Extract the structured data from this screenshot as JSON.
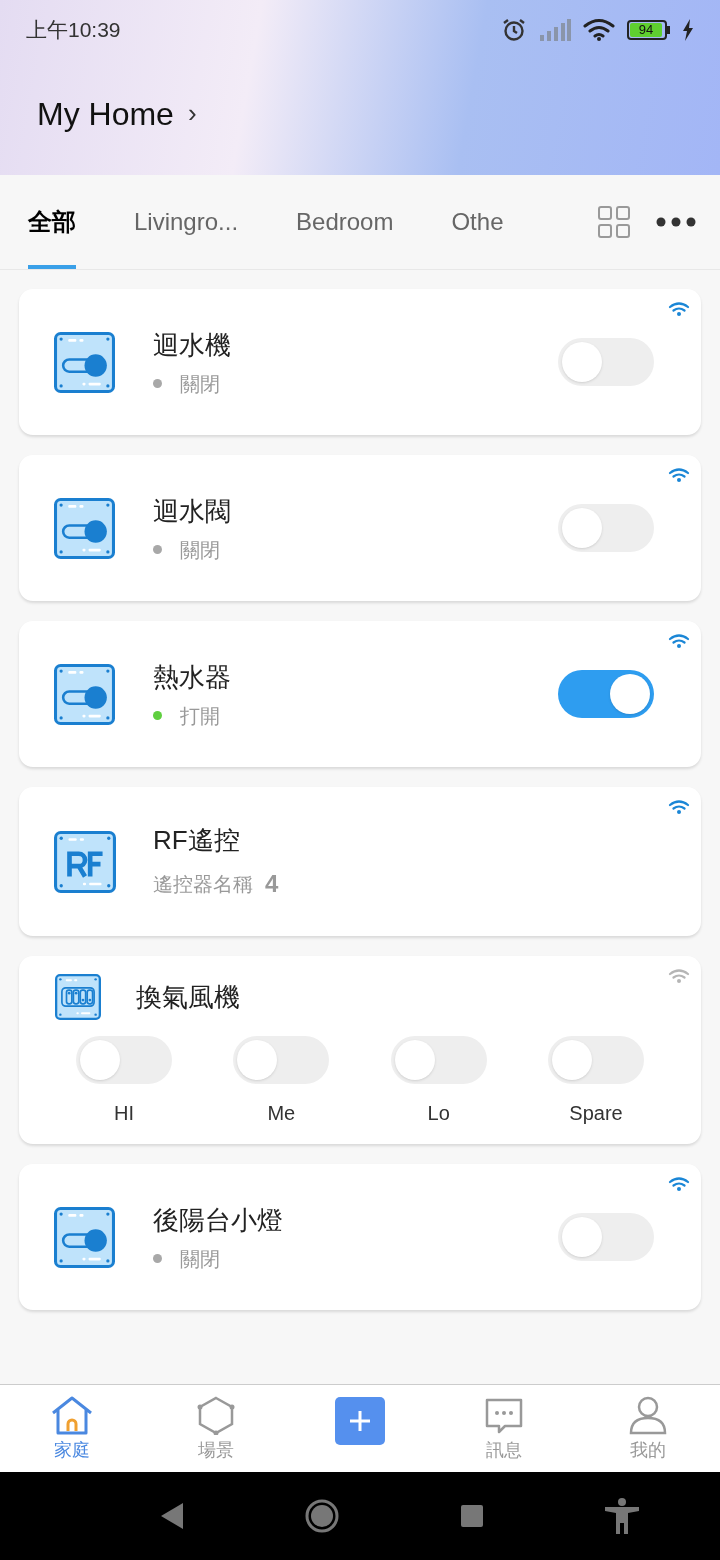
{
  "status_bar": {
    "time": "上午10:39",
    "battery": "94"
  },
  "header": {
    "title": "My Home",
    "chevron": "›"
  },
  "tabs": [
    {
      "label": "全部",
      "selected": true
    },
    {
      "label": "Livingro...",
      "selected": false
    },
    {
      "label": "Bedroom",
      "selected": false
    },
    {
      "label": "Othe",
      "selected": false
    }
  ],
  "devices": [
    {
      "kind": "switch",
      "name": "迴水機",
      "online": true,
      "on": false,
      "status": "關閉"
    },
    {
      "kind": "switch",
      "name": "迴水閥",
      "online": true,
      "on": false,
      "status": "關閉"
    },
    {
      "kind": "switch",
      "name": "熱水器",
      "online": true,
      "on": true,
      "status": "打開"
    },
    {
      "kind": "remote",
      "name": "RF遙控",
      "online": true,
      "subtitle": "遙控器名稱",
      "count": "4"
    },
    {
      "kind": "multi",
      "name": "換氣風機",
      "online": false,
      "switches": [
        {
          "label": "HI",
          "on": false
        },
        {
          "label": "Me",
          "on": false
        },
        {
          "label": "Lo",
          "on": false
        },
        {
          "label": "Spare",
          "on": false
        }
      ]
    },
    {
      "kind": "switch",
      "name": "後陽台小燈",
      "online": true,
      "on": false,
      "status": "關閉"
    }
  ],
  "bottom_nav": [
    {
      "kind": "home",
      "label": "家庭",
      "selected": true
    },
    {
      "kind": "scene",
      "label": "場景",
      "selected": false
    },
    {
      "kind": "add",
      "selected": false
    },
    {
      "kind": "message",
      "label": "訊息",
      "selected": false
    },
    {
      "kind": "profile",
      "label": "我的",
      "selected": false
    }
  ]
}
